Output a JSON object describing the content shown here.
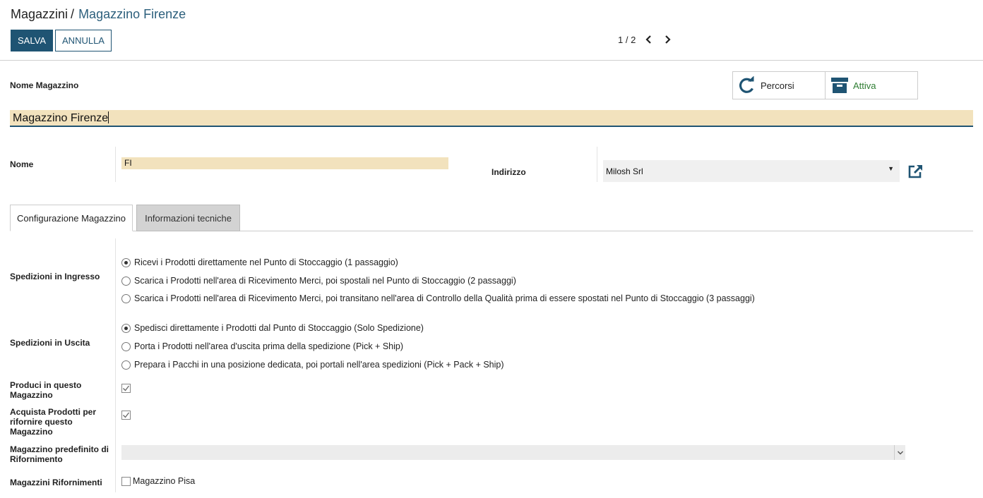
{
  "breadcrumb": {
    "parent": "Magazzini",
    "separator": "/",
    "current": "Magazzino Firenze"
  },
  "toolbar": {
    "save_label": "SALVA",
    "cancel_label": "ANNULLA"
  },
  "pager": {
    "value": "1 / 2"
  },
  "smart_buttons": {
    "routes_label": "Percorsi",
    "active_label": "Attiva"
  },
  "form": {
    "name_label": "Nome Magazzino",
    "name_value": "Magazzino Firenze",
    "code_label": "Nome",
    "code_value": "FI",
    "address_label": "Indirizzo",
    "address_value": "Milosh Srl"
  },
  "tabs": [
    {
      "label": "Configurazione Magazzino",
      "active": true
    },
    {
      "label": "Informazioni tecniche",
      "active": false
    }
  ],
  "incoming": {
    "label": "Spedizioni in Ingresso",
    "options": [
      {
        "label": "Ricevi i Prodotti direttamente nel Punto di Stoccaggio (1 passaggio)",
        "checked": true
      },
      {
        "label": "Scarica i Prodotti nell'area di Ricevimento Merci, poi spostali nel Punto di Stoccaggio (2 passaggi)",
        "checked": false
      },
      {
        "label": "Scarica i Prodotti nell'area di Ricevimento Merci, poi transitano nell'area di Controllo della Qualità prima di essere spostati nel Punto di Stoccaggio (3 passaggi)",
        "checked": false
      }
    ]
  },
  "outgoing": {
    "label": "Spedizioni in Uscita",
    "options": [
      {
        "label": "Spedisci direttamente i Prodotti dal Punto di Stoccaggio (Solo Spedizione)",
        "checked": true
      },
      {
        "label": "Porta i Prodotti nell'area d'uscita prima della spedizione (Pick + Ship)",
        "checked": false
      },
      {
        "label": "Prepara i Pacchi in una posizione dedicata, poi portali nell'area spedizioni (Pick + Pack + Ship)",
        "checked": false
      }
    ]
  },
  "manufacture": {
    "label": "Produci in questo Magazzino",
    "checked": true
  },
  "buy": {
    "label": "Acquista Prodotti per rifornire questo Magazzino",
    "checked": true
  },
  "default_resupply": {
    "label": "Magazzino predefinito di Rifornimento",
    "value": ""
  },
  "resupply": {
    "label": "Magazzini Rifornimenti",
    "option_label": "Magazzino Pisa",
    "checked": false
  },
  "colors": {
    "primary": "#1f5473",
    "required_bg": "#f2e2bd",
    "inactive_tab": "#d3d3d3",
    "active_green": "#2e7d32"
  },
  "icons": {
    "routes": "refresh-icon",
    "active": "archive-icon",
    "external": "external-link-icon",
    "prev": "chevron-left-icon",
    "next": "chevron-right-icon"
  }
}
